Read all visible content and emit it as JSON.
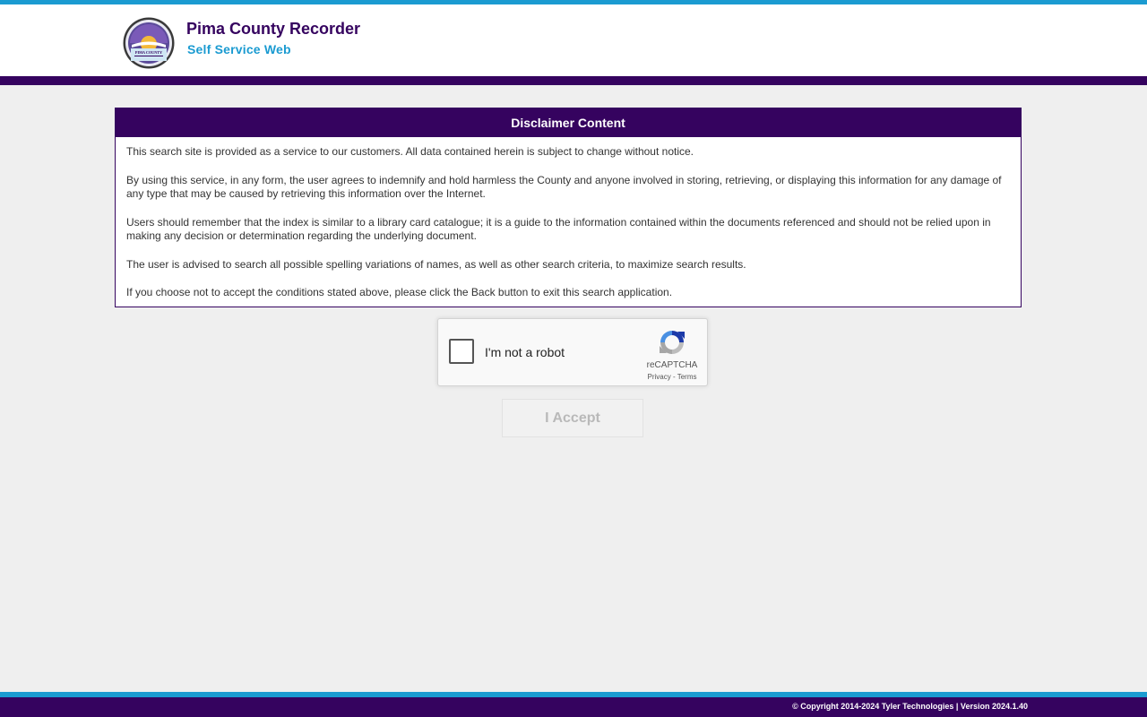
{
  "header": {
    "title": "Pima County Recorder",
    "subtitle": "Self Service Web",
    "logo_text": "PIMA COUNTY"
  },
  "disclaimer": {
    "heading": "Disclaimer Content",
    "paragraphs": [
      "This search site is provided as a service to our customers. All data contained herein is subject to change without notice.",
      "By using this service, in any form, the user agrees to indemnify and hold harmless the County and anyone involved in storing, retrieving, or displaying this information for any damage of any type that may be caused by retrieving this information over the Internet.",
      "Users should remember that the index is similar to a library card catalogue; it is a guide to the information contained within the documents referenced and should not be relied upon in making any decision or determination regarding the underlying document.",
      "The user is advised to search all possible spelling variations of names, as well as other search criteria, to maximize search results.",
      "If you choose not to accept the conditions stated above, please click the Back button to exit this search application."
    ]
  },
  "captcha": {
    "label": "I'm not a robot",
    "brand": "reCAPTCHA",
    "privacy": "Privacy",
    "separator": " - ",
    "terms": "Terms",
    "checked": false
  },
  "accept_button": {
    "label": "I Accept",
    "disabled": true
  },
  "footer": {
    "text": "© Copyright 2014-2024 Tyler Technologies | Version 2024.1.40"
  },
  "colors": {
    "brand_purple": "#35035f",
    "brand_blue": "#1b9bd1",
    "background": "#efefef"
  }
}
